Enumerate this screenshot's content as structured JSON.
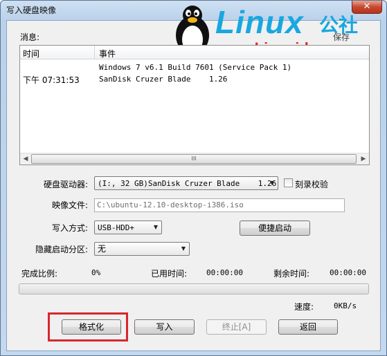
{
  "window": {
    "title": "写入硬盘映像",
    "close_glyph": "✕"
  },
  "watermark": {
    "brand": "Linux",
    "brand_cn": "公社",
    "url": "www.Linuxidc.com",
    "partial_text": "保存"
  },
  "messages": {
    "label": "消息:",
    "columns": [
      "时间",
      "事件"
    ],
    "rows": [
      {
        "time": "",
        "event": "Windows 7 v6.1 Build 7601 (Service Pack 1)"
      },
      {
        "time": "下午 07:31:53",
        "event": "SanDisk Cruzer Blade    1.26"
      }
    ],
    "scroll_left": "◀",
    "scroll_right": "▶",
    "scroll_grip": "III"
  },
  "form": {
    "drive_label": "硬盘驱动器:",
    "drive_value": "(I:, 32 GB)SanDisk Cruzer Blade    1.26",
    "verify_label": "刻录校验",
    "verify_checked": false,
    "image_label": "映像文件:",
    "image_value": "C:\\ubuntu-12.10-desktop-i386.iso",
    "write_mode_label": "写入方式:",
    "write_mode_value": "USB-HDD+",
    "boot_button": "便捷启动",
    "hidden_partition_label": "隐藏启动分区:",
    "hidden_partition_value": "无"
  },
  "status": {
    "complete_label": "完成比例:",
    "complete_value": "0%",
    "progress": 0,
    "elapsed_label": "已用时间:",
    "elapsed_value": "00:00:00",
    "remaining_label": "剩余时间:",
    "remaining_value": "00:00:00",
    "speed_label": "速度:",
    "speed_value": "0KB/s"
  },
  "buttons": {
    "format": "格式化",
    "write": "写入",
    "stop": "终止[A]",
    "back": "返回"
  },
  "colors": {
    "highlight_box": "#d7262c",
    "logo_blue": "#19a7e0",
    "logo_red": "#e0262b"
  }
}
